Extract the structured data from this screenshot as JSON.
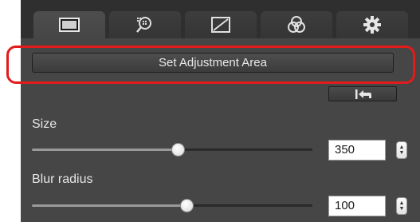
{
  "tabs": [
    {
      "icon": "image-view-icon",
      "active": true
    },
    {
      "icon": "zoom-grid-icon",
      "active": false
    },
    {
      "icon": "tone-curve-icon",
      "active": false
    },
    {
      "icon": "color-circles-icon",
      "active": false
    },
    {
      "icon": "gear-icon",
      "active": false
    }
  ],
  "set_area_button": {
    "label": "Set Adjustment Area"
  },
  "undo_button": {
    "icon": "undo-arrow-icon"
  },
  "size_control": {
    "label": "Size",
    "value": "350",
    "slider_fraction": 0.52
  },
  "blur_control": {
    "label": "Blur radius",
    "value": "100",
    "slider_fraction": 0.55
  },
  "colors": {
    "highlight": "#e21b1b",
    "panel": "#464646",
    "tabbar": "#2f2f2f"
  }
}
